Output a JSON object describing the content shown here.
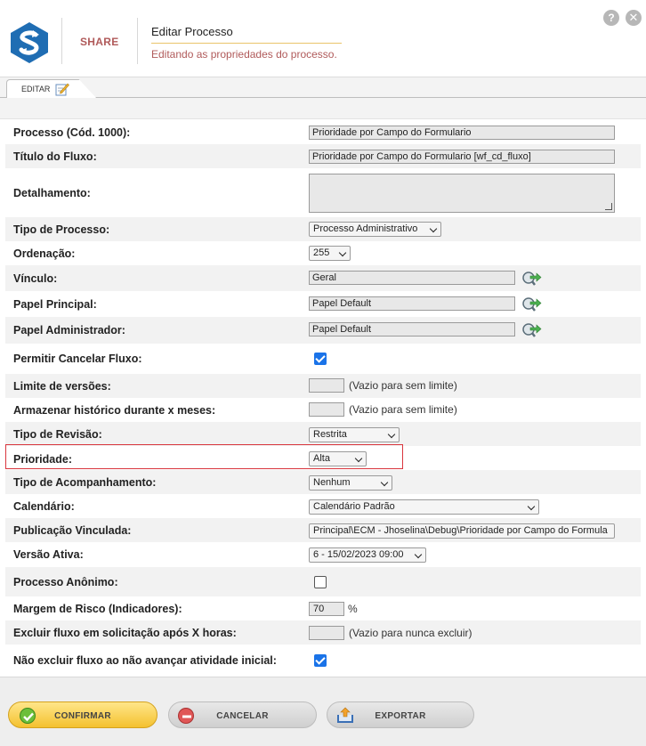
{
  "header": {
    "brand": "SHARE",
    "title": "Editar Processo",
    "subtitle": "Editando as propriedades do processo.",
    "help_label": "?",
    "close_label": "✕"
  },
  "tabs": [
    {
      "label": "EDITAR",
      "active": true
    }
  ],
  "form": {
    "processo": {
      "label": "Processo (Cód. 1000):",
      "value": "Prioridade por Campo do Formulario"
    },
    "titulo": {
      "label": "Título do Fluxo:",
      "value": "Prioridade por Campo do Formulario [wf_cd_fluxo]"
    },
    "detalhamento": {
      "label": "Detalhamento:",
      "value": ""
    },
    "tipo_processo": {
      "label": "Tipo de Processo:",
      "value": "Processo Administrativo"
    },
    "ordenacao": {
      "label": "Ordenação:",
      "value": "255"
    },
    "vinculo": {
      "label": "Vínculo:",
      "value": "Geral"
    },
    "papel_principal": {
      "label": "Papel Principal:",
      "value": "Papel Default"
    },
    "papel_admin": {
      "label": "Papel Administrador:",
      "value": "Papel Default"
    },
    "permitir_cancelar": {
      "label": "Permitir Cancelar Fluxo:",
      "checked": true
    },
    "limite_versoes": {
      "label": "Limite de versões:",
      "value": "",
      "hint": "(Vazio para sem limite)"
    },
    "armazenar_historico": {
      "label": "Armazenar histórico durante x meses:",
      "value": "",
      "hint": "(Vazio para sem limite)"
    },
    "tipo_revisao": {
      "label": "Tipo de Revisão:",
      "value": "Restrita"
    },
    "prioridade": {
      "label": "Prioridade:",
      "value": "Alta"
    },
    "tipo_acompanhamento": {
      "label": "Tipo de Acompanhamento:",
      "value": "Nenhum"
    },
    "calendario": {
      "label": "Calendário:",
      "value": "Calendário Padrão"
    },
    "publicacao": {
      "label": "Publicação Vinculada:",
      "value": "Principal\\ECM - Jhoselina\\Debug\\Prioridade por Campo do Formula"
    },
    "versao_ativa": {
      "label": "Versão Ativa:",
      "value": "6 - 15/02/2023 09:00"
    },
    "processo_anonimo": {
      "label": "Processo Anônimo:",
      "checked": false
    },
    "margem_risco": {
      "label": "Margem de Risco (Indicadores):",
      "value": "70",
      "unit": "%"
    },
    "excluir_fluxo": {
      "label": "Excluir fluxo em solicitação após X horas:",
      "value": "",
      "hint": "(Vazio para nunca excluir)"
    },
    "nao_excluir": {
      "label": "Não excluir fluxo ao não avançar atividade inicial:",
      "checked": true
    }
  },
  "footer": {
    "confirm_label": "CONFIRMAR",
    "cancel_label": "CANCELAR",
    "export_label": "EXPORTAR"
  },
  "colors": {
    "brand_red": "#b05a5a",
    "accent_yellow": "#f4c12f",
    "highlight_red": "#d9363e",
    "checkbox_blue": "#1a73e8"
  },
  "icons": [
    "app-logo-icon",
    "help-icon",
    "close-icon",
    "edit-icon",
    "search-arrow-icon",
    "check-icon",
    "cancel-icon",
    "export-icon"
  ]
}
